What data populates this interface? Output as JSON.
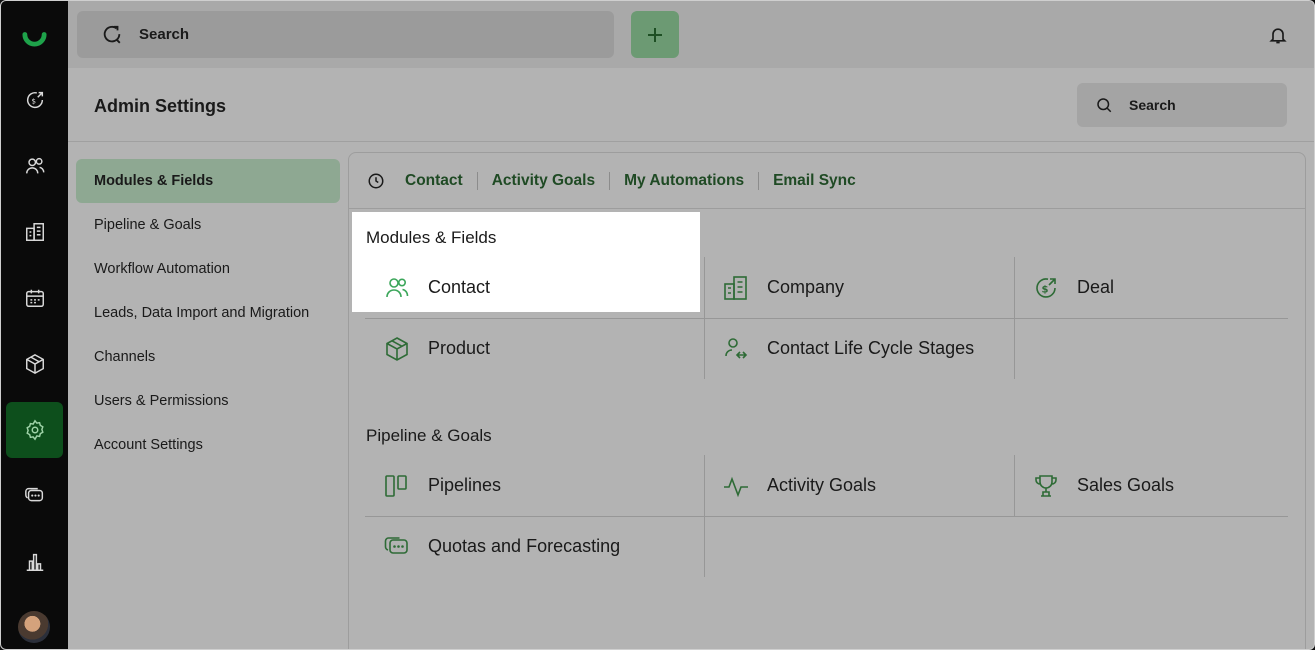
{
  "topbar": {
    "search_label": "Search"
  },
  "admin": {
    "title": "Admin Settings",
    "search_label": "Search"
  },
  "settings_nav": [
    {
      "label": "Modules & Fields"
    },
    {
      "label": "Pipeline & Goals"
    },
    {
      "label": "Workflow Automation"
    },
    {
      "label": "Leads, Data Import and Migration"
    },
    {
      "label": "Channels"
    },
    {
      "label": "Users & Permissions"
    },
    {
      "label": "Account Settings"
    }
  ],
  "recent_tabs": [
    "Contact",
    "Activity Goals",
    "My Automations",
    "Email Sync"
  ],
  "sections": {
    "modules": {
      "title": "Modules & Fields",
      "items": [
        "Contact",
        "Company",
        "Deal",
        "Product",
        "Contact Life Cycle Stages"
      ]
    },
    "pipeline": {
      "title": "Pipeline & Goals",
      "items": [
        "Pipelines",
        "Activity Goals",
        "Sales Goals",
        "Quotas and Forecasting"
      ]
    }
  },
  "colors": {
    "accent": "#0d4f1c",
    "icon_green": "#2e6b36",
    "highlight_icon": "#3ba65a",
    "overlay": "#b3b3b3"
  },
  "icons": {
    "rail": [
      "logo-icon",
      "deals-icon",
      "contacts-icon",
      "companies-icon",
      "calendar-icon",
      "products-icon",
      "settings-icon",
      "chat-icon",
      "reports-icon"
    ]
  }
}
